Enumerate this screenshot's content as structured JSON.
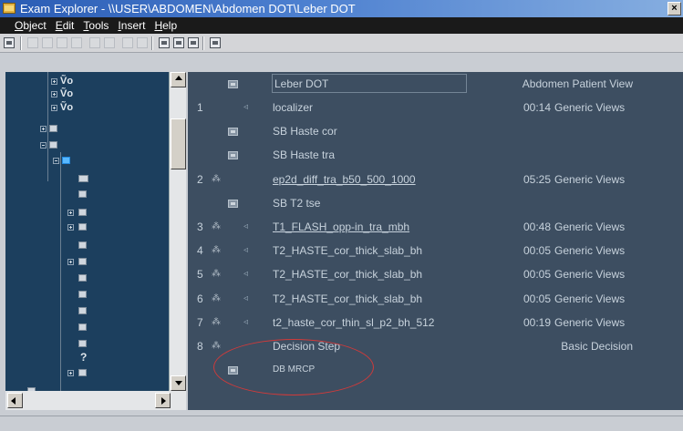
{
  "window": {
    "title": "Exam Explorer - \\\\USER\\ABDOMEN\\Abdomen DOT\\Leber DOT",
    "close_glyph": "×"
  },
  "menu": [
    "Object",
    "Edit",
    "Tools",
    "Insert",
    "Help"
  ],
  "tree": {
    "label_glyphs": [
      "Ṽo",
      "Ṽo",
      "Ṽo",
      "?"
    ]
  },
  "list": {
    "header": {
      "name": "Leber DOT",
      "view": "Abdomen Patient View",
      "icon": "program-icon"
    },
    "rows": [
      {
        "num": "1",
        "person": "",
        "speaker": "◃",
        "folder": false,
        "name": "localizer",
        "underlined": false,
        "duration": "00:14",
        "view": "Generic Views"
      },
      {
        "num": "",
        "person": "",
        "speaker": "",
        "folder": true,
        "name": "SB Haste cor",
        "underlined": false,
        "duration": "",
        "view": ""
      },
      {
        "num": "",
        "person": "",
        "speaker": "",
        "folder": true,
        "name": "SB Haste tra",
        "underlined": false,
        "duration": "",
        "view": ""
      },
      {
        "num": "2",
        "person": "⁂",
        "speaker": "",
        "folder": false,
        "name": "ep2d_diff_tra_b50_500_1000",
        "underlined": true,
        "duration": "05:25",
        "view": "Generic Views"
      },
      {
        "num": "",
        "person": "",
        "speaker": "",
        "folder": true,
        "name": "SB T2 tse",
        "underlined": false,
        "duration": "",
        "view": ""
      },
      {
        "num": "3",
        "person": "⁂",
        "speaker": "◃",
        "folder": false,
        "name": "T1_FLASH_opp-in_tra_mbh",
        "underlined": true,
        "duration": "00:48",
        "view": "Generic Views"
      },
      {
        "num": "4",
        "person": "⁂",
        "speaker": "◃",
        "folder": false,
        "name": "T2_HASTE_cor_thick_slab_bh",
        "underlined": false,
        "duration": "00:05",
        "view": "Generic Views"
      },
      {
        "num": "5",
        "person": "⁂",
        "speaker": "◃",
        "folder": false,
        "name": "T2_HASTE_cor_thick_slab_bh",
        "underlined": false,
        "duration": "00:05",
        "view": "Generic Views"
      },
      {
        "num": "6",
        "person": "⁂",
        "speaker": "◃",
        "folder": false,
        "name": "T2_HASTE_cor_thick_slab_bh",
        "underlined": false,
        "duration": "00:05",
        "view": "Generic Views"
      },
      {
        "num": "7",
        "person": "⁂",
        "speaker": "◃",
        "folder": false,
        "name": "t2_haste_cor_thin_sl_p2_bh_512",
        "underlined": false,
        "duration": "00:19",
        "view": "Generic Views"
      },
      {
        "num": "8",
        "person": "⁂",
        "speaker": "",
        "folder": false,
        "name": "Decision Step",
        "underlined": false,
        "duration": "",
        "view": "Basic Decision"
      },
      {
        "num": "",
        "person": "",
        "speaker": "",
        "folder": true,
        "name": "DB MRCP",
        "underlined": false,
        "duration": "",
        "view": ""
      }
    ]
  },
  "annotation": {
    "color": "#d03a3a"
  }
}
